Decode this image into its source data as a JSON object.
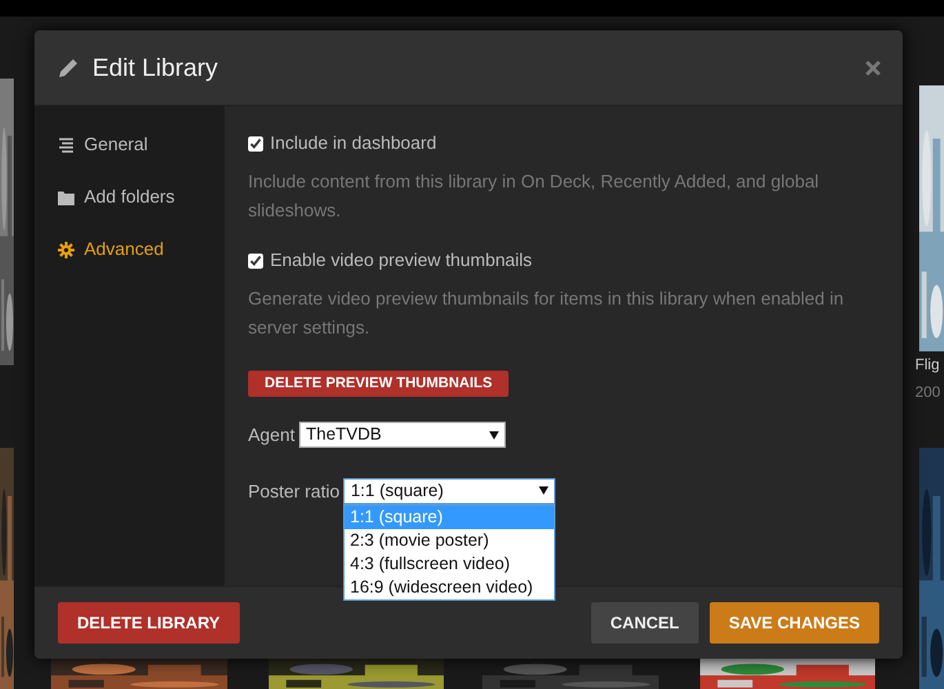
{
  "background": {
    "side_item": {
      "title": "Flig",
      "year": "200"
    }
  },
  "dialog": {
    "title": "Edit Library",
    "sidebar": {
      "items": [
        {
          "label": "General",
          "kind": "list",
          "selected": false
        },
        {
          "label": "Add folders",
          "kind": "folder",
          "selected": false
        },
        {
          "label": "Advanced",
          "kind": "gear",
          "selected": true
        }
      ]
    },
    "settings": [
      {
        "label": "Include in dashboard",
        "checked": true,
        "description": "Include content from this library in On Deck, Recently Added, and global slideshows."
      },
      {
        "label": "Enable video preview thumbnails",
        "checked": true,
        "description": "Generate video preview thumbnails for items in this library when enabled in server settings."
      }
    ],
    "delete_thumbnails_button": "DELETE PREVIEW THUMBNAILS",
    "agent": {
      "label": "Agent",
      "value": "TheTVDB",
      "expanded": false
    },
    "poster_ratio": {
      "label": "Poster ratio",
      "value": "1:1 (square)",
      "expanded": true,
      "options": [
        {
          "label": "1:1 (square)",
          "selected": true
        },
        {
          "label": "2:3 (movie poster)",
          "selected": false
        },
        {
          "label": "4:3 (fullscreen video)",
          "selected": false
        },
        {
          "label": "16:9 (widescreen video)",
          "selected": false
        }
      ]
    },
    "footer_buttons": [
      {
        "label": "DELETE LIBRARY",
        "kind": "danger"
      },
      {
        "label": "CANCEL",
        "kind": "secondary"
      },
      {
        "label": "SAVE CHANGES",
        "kind": "primary"
      }
    ]
  }
}
